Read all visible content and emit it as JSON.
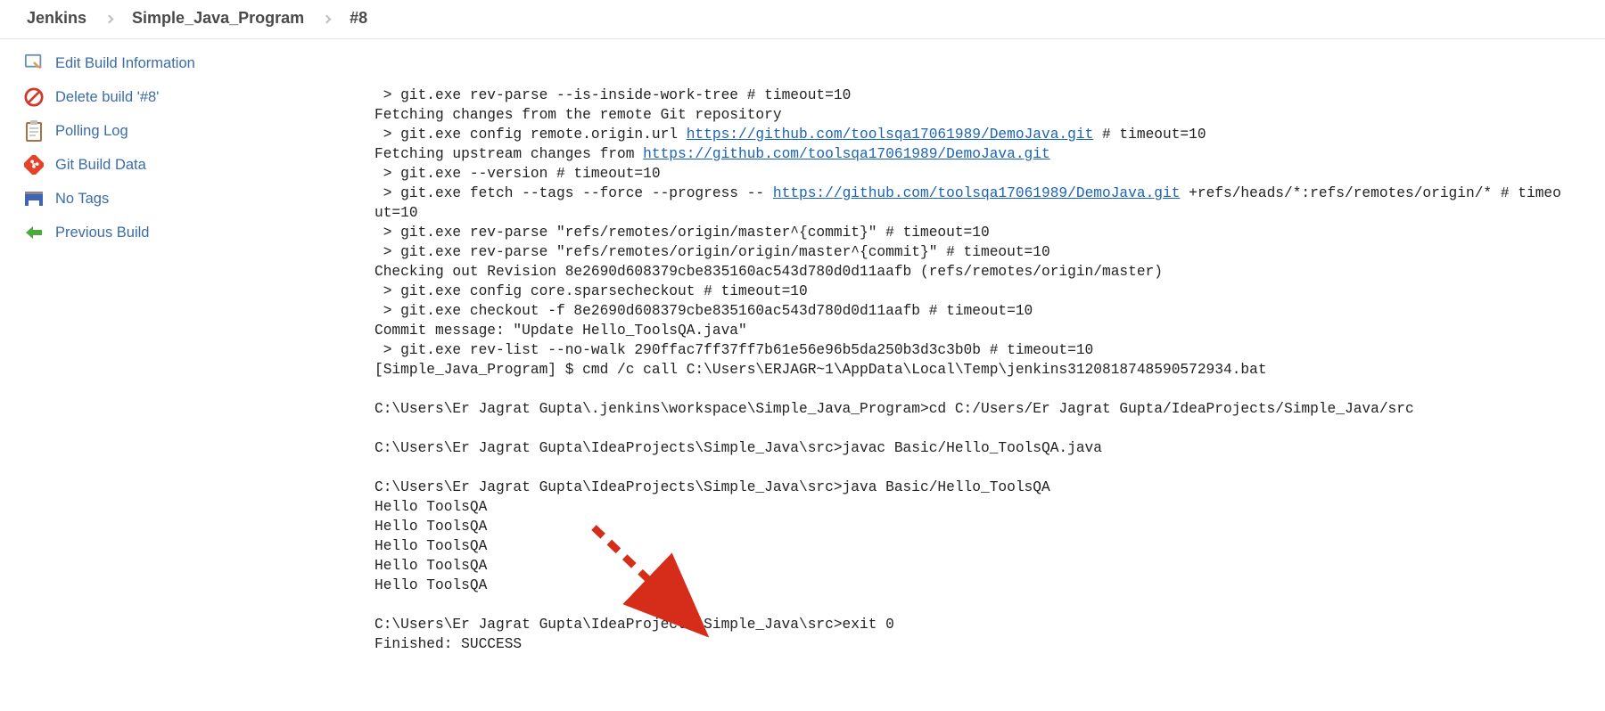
{
  "breadcrumbs": [
    "Jenkins",
    "Simple_Java_Program",
    "#8"
  ],
  "sidebar": {
    "items": [
      {
        "label": "Edit Build Information"
      },
      {
        "label": "Delete build '#8'"
      },
      {
        "label": "Polling Log"
      },
      {
        "label": "Git Build Data"
      },
      {
        "label": "No Tags"
      },
      {
        "label": "Previous Build"
      }
    ]
  },
  "console": {
    "lines": [
      {
        "pre": " > git.exe rev-parse --is-inside-work-tree # timeout=10"
      },
      {
        "pre": "Fetching changes from the remote Git repository"
      },
      {
        "pre": " > git.exe config remote.origin.url ",
        "link": "https://github.com/toolsqa17061989/DemoJava.git",
        "post": " # timeout=10"
      },
      {
        "pre": "Fetching upstream changes from ",
        "link": "https://github.com/toolsqa17061989/DemoJava.git",
        "post": ""
      },
      {
        "pre": " > git.exe --version # timeout=10"
      },
      {
        "pre": " > git.exe fetch --tags --force --progress -- ",
        "link": "https://github.com/toolsqa17061989/DemoJava.git",
        "post": " +refs/heads/*:refs/remotes/origin/* # timeout=10"
      },
      {
        "pre": " > git.exe rev-parse \"refs/remotes/origin/master^{commit}\" # timeout=10"
      },
      {
        "pre": " > git.exe rev-parse \"refs/remotes/origin/origin/master^{commit}\" # timeout=10"
      },
      {
        "pre": "Checking out Revision 8e2690d608379cbe835160ac543d780d0d11aafb (refs/remotes/origin/master)"
      },
      {
        "pre": " > git.exe config core.sparsecheckout # timeout=10"
      },
      {
        "pre": " > git.exe checkout -f 8e2690d608379cbe835160ac543d780d0d11aafb # timeout=10"
      },
      {
        "pre": "Commit message: \"Update Hello_ToolsQA.java\""
      },
      {
        "pre": " > git.exe rev-list --no-walk 290ffac7ff37ff7b61e56e96b5da250b3d3c3b0b # timeout=10"
      },
      {
        "pre": "[Simple_Java_Program] $ cmd /c call C:\\Users\\ERJAGR~1\\AppData\\Local\\Temp\\jenkins3120818748590572934.bat"
      },
      {
        "pre": ""
      },
      {
        "pre": "C:\\Users\\Er Jagrat Gupta\\.jenkins\\workspace\\Simple_Java_Program>cd C:/Users/Er Jagrat Gupta/IdeaProjects/Simple_Java/src"
      },
      {
        "pre": ""
      },
      {
        "pre": "C:\\Users\\Er Jagrat Gupta\\IdeaProjects\\Simple_Java\\src>javac Basic/Hello_ToolsQA.java"
      },
      {
        "pre": ""
      },
      {
        "pre": "C:\\Users\\Er Jagrat Gupta\\IdeaProjects\\Simple_Java\\src>java Basic/Hello_ToolsQA"
      },
      {
        "pre": "Hello ToolsQA"
      },
      {
        "pre": "Hello ToolsQA"
      },
      {
        "pre": "Hello ToolsQA"
      },
      {
        "pre": "Hello ToolsQA"
      },
      {
        "pre": "Hello ToolsQA"
      },
      {
        "pre": ""
      },
      {
        "pre": "C:\\Users\\Er Jagrat Gupta\\IdeaProjects\\Simple_Java\\src>exit 0 "
      },
      {
        "pre": "Finished: SUCCESS"
      }
    ]
  }
}
